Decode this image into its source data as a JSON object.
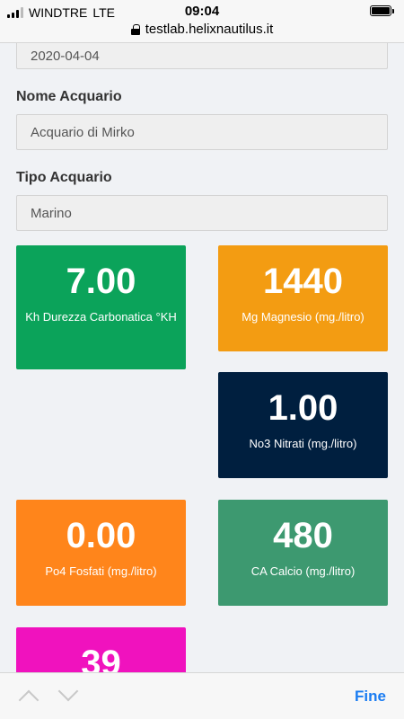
{
  "status_bar": {
    "carrier": "WINDTRE",
    "network": "LTE",
    "time": "09:04",
    "url": "testlab.helixnautilus.it",
    "battery_level": 1.0
  },
  "form": {
    "date_value": "2020-04-04",
    "aquarium_name_label": "Nome Acquario",
    "aquarium_name_value": "Acquario di Mirko",
    "aquarium_type_label": "Tipo Acquario",
    "aquarium_type_value": "Marino"
  },
  "tiles": [
    {
      "value": "7.00",
      "label": "Kh Durezza Carbonatica °KH",
      "color": "#0ba35a"
    },
    {
      "value": "1440",
      "label": "Mg Magnesio (mg./litro)",
      "color": "#f39c12"
    },
    {
      "value": "1.00",
      "label": "No3 Nitrati (mg./litro)",
      "color": "#001f3f"
    },
    {
      "value": "0.00",
      "label": "Po4 Fosfati (mg./litro)",
      "color": "#ff851b"
    },
    {
      "value": "480",
      "label": "CA Calcio (mg./litro)",
      "color": "#3d9970"
    },
    {
      "value": "39",
      "label": "",
      "color": "#f012be"
    }
  ],
  "keyboard_toolbar": {
    "done_label": "Fine"
  }
}
